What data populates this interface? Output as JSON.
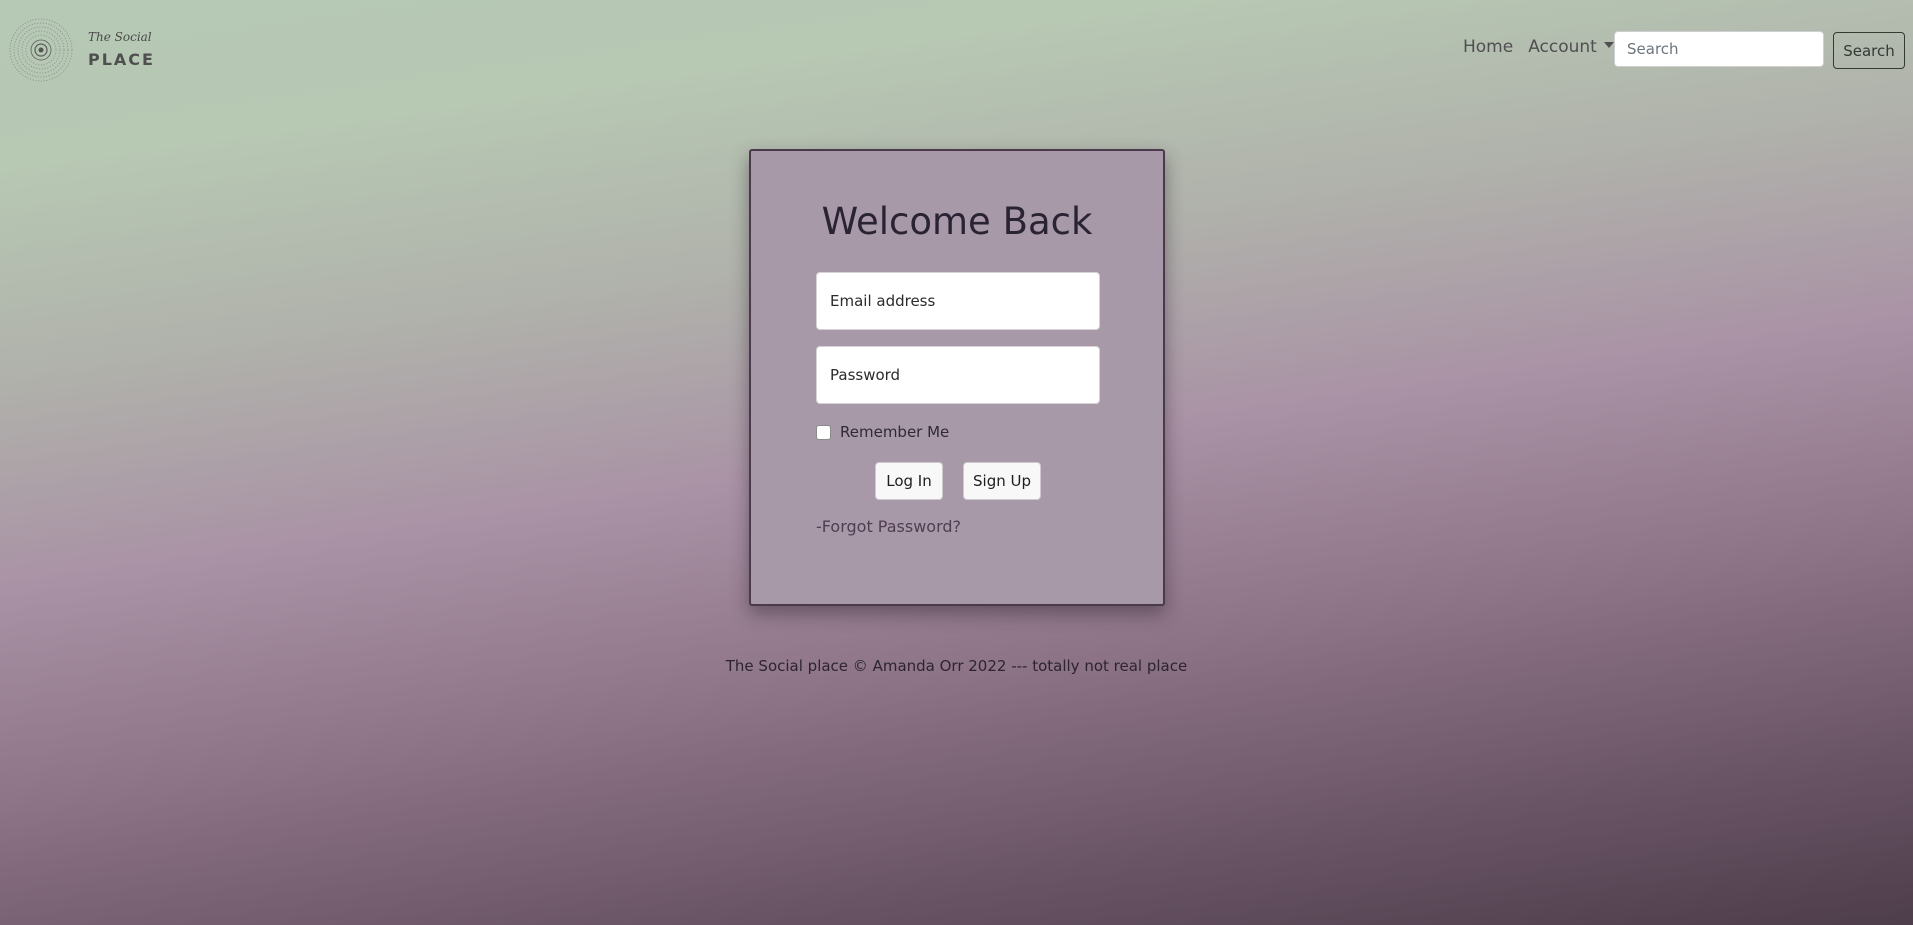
{
  "brand": {
    "top_text": "The Social",
    "bottom_text": "PLACE",
    "logo_icon": "concentric-circles-logo-icon"
  },
  "nav": {
    "home": "Home",
    "account": "Account",
    "search_placeholder": "Search",
    "search_button": "Search"
  },
  "login": {
    "title": "Welcome Back",
    "email_placeholder": "Email address",
    "password_placeholder": "Password",
    "remember_label": "Remember Me",
    "login_button": "Log In",
    "signup_button": "Sign Up",
    "forgot_link": "-Forgot Password?"
  },
  "footer": {
    "text": "The Social place © Amanda Orr 2022 --- totally not real place"
  },
  "colors": {
    "card_background": "#a899a8",
    "card_border": "#4a3a4c",
    "gradient_top": "#b5c9b4",
    "gradient_mid": "#a991a5",
    "gradient_bottom": "#4e3d4b"
  }
}
